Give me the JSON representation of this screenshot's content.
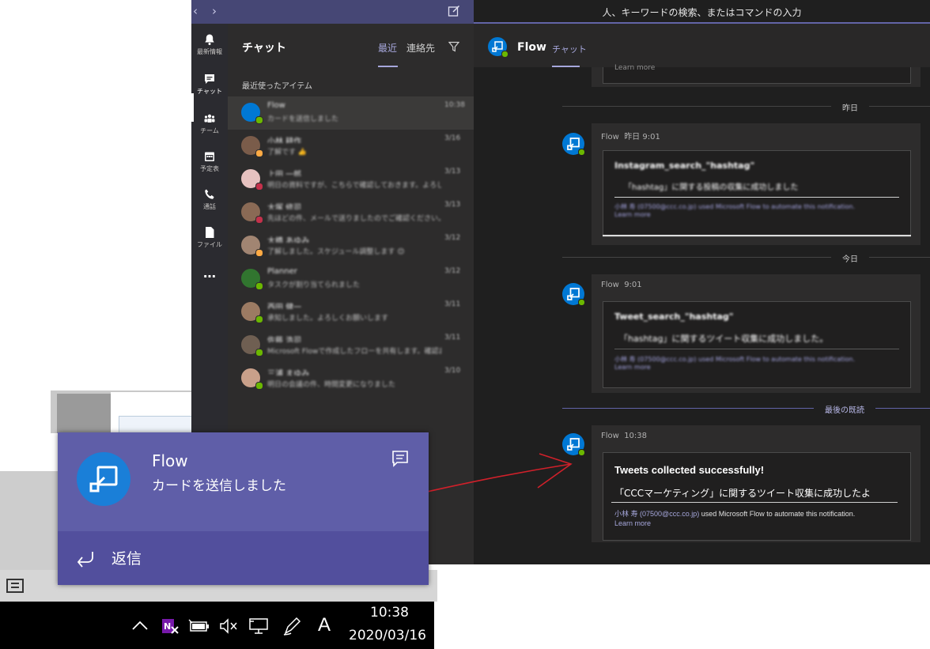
{
  "teams": {
    "search_placeholder": "人、キーワードの検索、またはコマンドの入力",
    "rail": [
      {
        "label": "最新情報",
        "icon": "bell-icon"
      },
      {
        "label": "チャット",
        "icon": "chat-icon"
      },
      {
        "label": "チーム",
        "icon": "teams-icon"
      },
      {
        "label": "予定表",
        "icon": "calendar-icon"
      },
      {
        "label": "通話",
        "icon": "phone-icon"
      },
      {
        "label": "ファイル",
        "icon": "file-icon"
      },
      {
        "label": "…",
        "icon": "more-icon"
      }
    ],
    "chatlist": {
      "title": "チャット",
      "tab_recent": "最近",
      "tab_contacts": "連絡先",
      "recent_label": "最近使ったアイテム",
      "rows": [
        {
          "name": "Flow",
          "preview": "カードを送信しました",
          "time": "10:38",
          "avatar_color": "#0078d4",
          "presence": "#6bb700"
        },
        {
          "name": "小林 耕作",
          "preview": "了解です 👍",
          "time": "3/16",
          "avatar_color": "#7a5c4a",
          "presence": "#ffaa44"
        },
        {
          "name": "上田 一郎",
          "preview": "明日の資料ですが、こちらで確認しておきます。よろしくお願いします",
          "time": "3/13",
          "avatar_color": "#e7c2c0",
          "presence": "#c4314b"
        },
        {
          "name": "大塚 修司",
          "preview": "先ほどの件、メールで送りましたのでご確認ください。ありがとうございます",
          "time": "3/13",
          "avatar_color": "#8a6a55",
          "presence": "#c4314b"
        },
        {
          "name": "大橋 あゆみ",
          "preview": "了解しました。スケジュール調整します 😊",
          "time": "3/12",
          "avatar_color": "#a18572",
          "presence": "#ffaa44"
        },
        {
          "name": "Planner",
          "preview": "タスクが割り当てられました",
          "time": "3/12",
          "avatar_color": "#31752f",
          "presence": "#6bb700"
        },
        {
          "name": "西田 健一",
          "preview": "承知しました。よろしくお願いします",
          "time": "3/11",
          "avatar_color": "#9c7b63",
          "presence": "#6bb700"
        },
        {
          "name": "佐藤 浩司",
          "preview": "Microsoft Flowで作成したフローを共有します。確認お願いします",
          "time": "3/11",
          "avatar_color": "#6f5f52",
          "presence": "#6bb700"
        },
        {
          "name": "三浦 まゆみ",
          "preview": "明日の会議の件、時間変更になりました",
          "time": "3/10",
          "avatar_color": "#c9a08a",
          "presence": "#6bb700"
        }
      ]
    },
    "conversation": {
      "title": "Flow",
      "tab": "チャット",
      "truncated_top": "Learn more",
      "day1": "昨日",
      "day2": "今日",
      "last_read": "最後の既読",
      "messages": [
        {
          "sender": "Flow",
          "time": "昨日 9:01",
          "card_title": "Instagram_search_\"hashtag\"",
          "card_body": "「hashtag」に関する投稿の収集に成功しました",
          "card_footer": "小林 寿 (07500@ccc.co.jp) used Microsoft Flow to automate this notification.",
          "learn_more": "Learn more"
        },
        {
          "sender": "Flow",
          "time": "9:01",
          "card_title": "Tweet_search_\"hashtag\"",
          "card_body": "「hashtag」に関するツイート収集に成功しました。",
          "card_footer": "小林 寿 (07500@ccc.co.jp) used Microsoft Flow to automate this notification.",
          "learn_more": "Learn more"
        },
        {
          "sender": "Flow",
          "time": "10:38",
          "card_title": "Tweets collected successfully!",
          "card_body": "「CCCマーケティング」に関するツイート収集に成功したよ",
          "card_footer_name": "小林 寿",
          "card_footer_email": "(07500@ccc.co.jp)",
          "card_footer_rest": " used Microsoft Flow to automate this notification.",
          "learn_more": "Learn more"
        }
      ]
    }
  },
  "toast": {
    "title": "Flow",
    "body": "カードを送信しました",
    "reply_label": "返信"
  },
  "taskbar": {
    "time": "10:38",
    "date": "2020/03/16",
    "ime": "A"
  },
  "colors": {
    "teams_accent": "#6264a7",
    "toast_bg": "#5f5ea8",
    "annotation_arrow": "#d0202a"
  }
}
